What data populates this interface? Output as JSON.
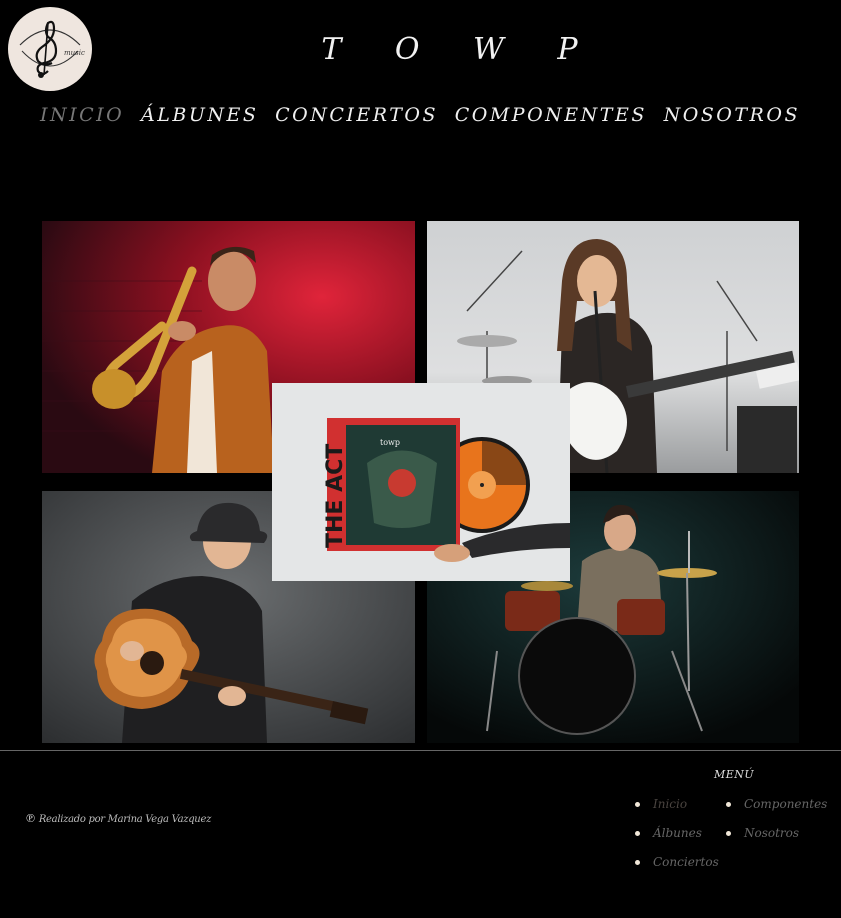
{
  "header": {
    "title": "T O W P",
    "logo_icon": "treble-clef-music-logo"
  },
  "nav": {
    "items": [
      {
        "label": "INICIO",
        "active": true
      },
      {
        "label": "ÁLBUNES",
        "active": false
      },
      {
        "label": "CONCIERTOS",
        "active": false
      },
      {
        "label": "COMPONENTES",
        "active": false
      },
      {
        "label": "NOSOTROS",
        "active": false
      }
    ]
  },
  "gallery": {
    "photos": [
      {
        "subject": "saxophone-player"
      },
      {
        "subject": "singer-guitarist"
      },
      {
        "subject": "acoustic-guitarist"
      },
      {
        "subject": "drummer"
      }
    ],
    "album": {
      "cover_title": "THE ACT",
      "cover_band": "towp",
      "vinyl_color": "#e8741c"
    }
  },
  "footer": {
    "credit": "Realizado por Marina Vega Vazquez",
    "credit_icon": "p-copyright-icon",
    "menu_title": "MENÚ",
    "links": [
      {
        "label": "Inicio"
      },
      {
        "label": "Álbunes"
      },
      {
        "label": "Conciertos"
      },
      {
        "label": "Componentes"
      },
      {
        "label": "Nosotros"
      }
    ]
  },
  "colors": {
    "background": "#000000",
    "nav_active": "#777777",
    "text": "#f0f0f0",
    "bullet": "#f0e7d8"
  }
}
